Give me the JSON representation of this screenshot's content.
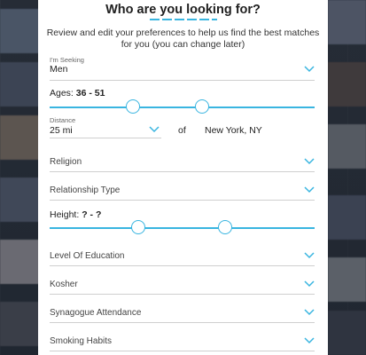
{
  "form": {
    "title": "Who are you looking for?",
    "subtitle": "Review and edit your preferences to help us find the best matches for you (you can change later)",
    "seeking": {
      "label": "I'm Seeking",
      "value": "Men"
    },
    "ages": {
      "label": "Ages:",
      "value": "36 - 51"
    },
    "distance": {
      "label": "Distance",
      "value": "25 mi",
      "of_label": "of",
      "location": "New York, NY"
    },
    "dropdowns": {
      "religion": "Religion",
      "relationship_type": "Relationship Type",
      "education": "Level Of Education",
      "kosher": "Kosher",
      "synagogue": "Synagogue Attendance",
      "smoking": "Smoking Habits"
    },
    "height": {
      "label": "Height:",
      "value": "? - ?"
    }
  },
  "icons": {
    "dropdown": "chevron-down-icon",
    "slider_handle": "circle-handle"
  },
  "colors": {
    "accent": "#39b5e0",
    "divider": "#cfcfcf",
    "text": "#222222",
    "background": "#ffffff"
  }
}
